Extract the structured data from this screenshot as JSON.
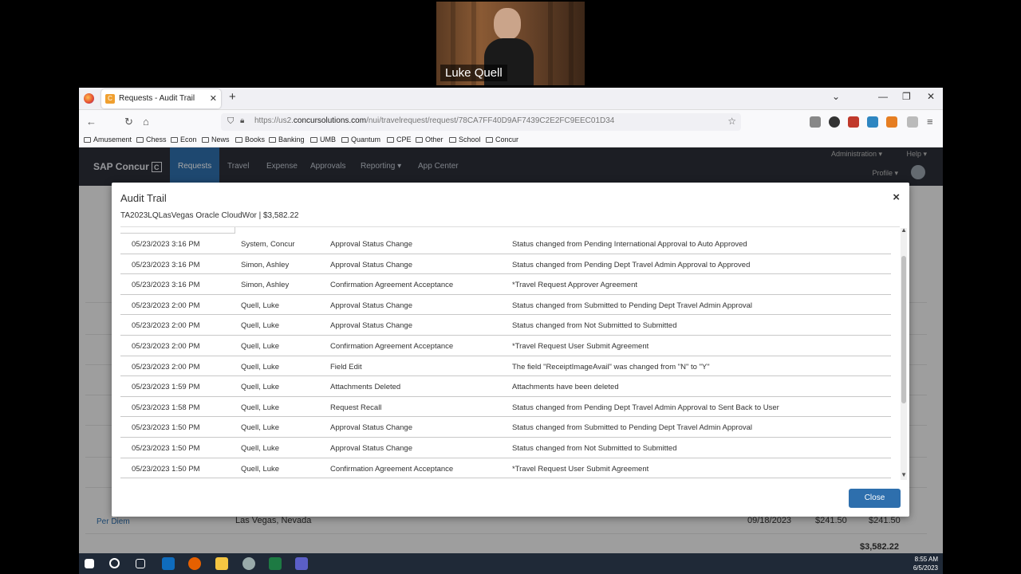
{
  "video": {
    "participant_name": "Luke Quell"
  },
  "browser": {
    "tab_title": "Requests - Audit Trail",
    "url_prefix": "https://us2.",
    "url_domain": "concursolutions.com",
    "url_path": "/nui/travelrequest/request/78CA7FF40D9AF7439C2E2FC9EEC01D34",
    "bookmarks": [
      "Amusement",
      "Chess",
      "Econ",
      "News",
      "Books",
      "Banking",
      "UMB",
      "Quantum",
      "CPE",
      "Other",
      "School",
      "Concur"
    ]
  },
  "concur": {
    "logo": "SAP Concur",
    "logo_mark": "C",
    "nav": [
      "Requests",
      "Travel",
      "Expense",
      "Approvals",
      "Reporting ▾",
      "App Center"
    ],
    "admin": "Administration ▾",
    "help": "Help ▾",
    "profile": "Profile ▾",
    "background": {
      "perdiem_label": "Per Diem",
      "perdiem_location": "Las Vegas, Nevada",
      "perdiem_date": "09/18/2023",
      "perdiem_amount_1": "$241.50",
      "perdiem_amount_2": "$241.50",
      "grand_total": "$3,582.22"
    }
  },
  "modal": {
    "title": "Audit Trail",
    "close_symbol": "×",
    "subtitle": "TA2023LQLasVegas Oracle CloudWor | $3,582.22",
    "close_button": "Close",
    "rows": [
      {
        "date": "05/23/2023 3:16 PM",
        "user": "System, Concur",
        "action": "Approval Status Change",
        "description": "Status changed from Pending International Approval to Auto Approved"
      },
      {
        "date": "05/23/2023 3:16 PM",
        "user": "Simon, Ashley",
        "action": "Approval Status Change",
        "description": "Status changed from Pending Dept Travel Admin Approval to Approved"
      },
      {
        "date": "05/23/2023 3:16 PM",
        "user": "Simon, Ashley",
        "action": "Confirmation Agreement Acceptance",
        "description": "*Travel Request Approver Agreement"
      },
      {
        "date": "05/23/2023 2:00 PM",
        "user": "Quell, Luke",
        "action": "Approval Status Change",
        "description": "Status changed from Submitted to Pending Dept Travel Admin Approval"
      },
      {
        "date": "05/23/2023 2:00 PM",
        "user": "Quell, Luke",
        "action": "Approval Status Change",
        "description": "Status changed from Not Submitted to Submitted"
      },
      {
        "date": "05/23/2023 2:00 PM",
        "user": "Quell, Luke",
        "action": "Confirmation Agreement Acceptance",
        "description": "*Travel Request User Submit Agreement"
      },
      {
        "date": "05/23/2023 2:00 PM",
        "user": "Quell, Luke",
        "action": "Field Edit",
        "description": "The field \"ReceiptImageAvail\" was changed from  \"N\" to \"Y\""
      },
      {
        "date": "05/23/2023 1:59 PM",
        "user": "Quell, Luke",
        "action": "Attachments Deleted",
        "description": "Attachments have been deleted"
      },
      {
        "date": "05/23/2023 1:58 PM",
        "user": "Quell, Luke",
        "action": "Request Recall",
        "description": "Status changed from Pending Dept Travel Admin Approval to Sent Back to User"
      },
      {
        "date": "05/23/2023 1:50 PM",
        "user": "Quell, Luke",
        "action": "Approval Status Change",
        "description": "Status changed from Submitted to Pending Dept Travel Admin Approval"
      },
      {
        "date": "05/23/2023 1:50 PM",
        "user": "Quell, Luke",
        "action": "Approval Status Change",
        "description": "Status changed from Not Submitted to Submitted"
      },
      {
        "date": "05/23/2023 1:50 PM",
        "user": "Quell, Luke",
        "action": "Confirmation Agreement Acceptance",
        "description": "*Travel Request User Submit Agreement"
      }
    ]
  },
  "taskbar": {
    "time": "8:55 AM",
    "date": "6/5/2023"
  },
  "colors": {
    "concur_nav_bg": "#2b2f38",
    "accent_blue": "#2e6fad"
  }
}
